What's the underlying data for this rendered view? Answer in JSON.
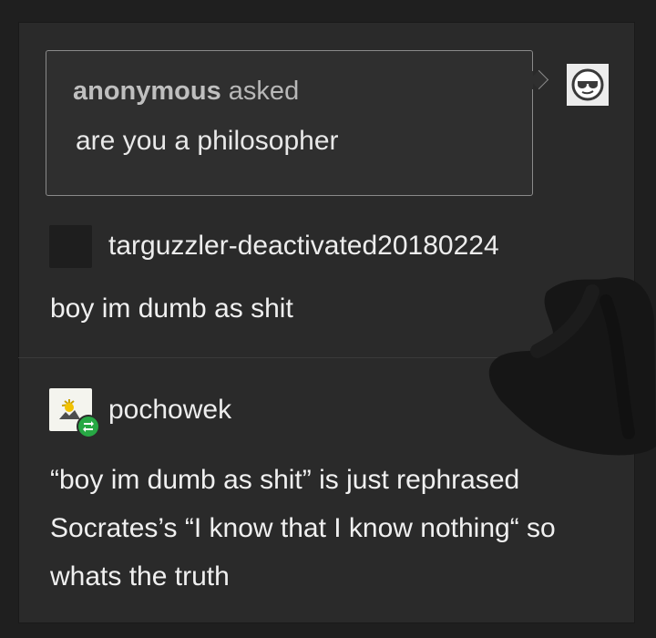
{
  "ask": {
    "asker": "anonymous",
    "verb": " asked",
    "question": "are you a philosopher"
  },
  "posts": [
    {
      "username": "targuzzler-deactivated20180224",
      "body": "boy im dumb as shit"
    },
    {
      "username": "pochowek",
      "body": "“boy im dumb as shit” is just rephrased Socrates’s “I know that I know nothing“ so whats the truth"
    }
  ],
  "colors": {
    "background": "#2a2a2a",
    "reblog_badge": "#27a844",
    "text": "#f0f0f0"
  },
  "icons": {
    "anon_avatar": "sunglasses-face-icon",
    "reblog": "reblog-icon"
  }
}
